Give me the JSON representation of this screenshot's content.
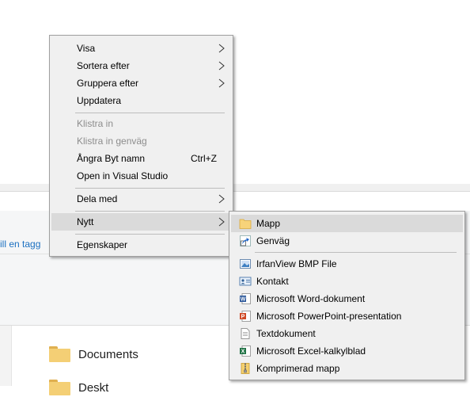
{
  "background": {
    "tag_link": "ill en tagg",
    "folders": [
      "Documents",
      "Deskt"
    ]
  },
  "context_menu": {
    "items": [
      {
        "label": "Visa",
        "submenu": true
      },
      {
        "label": "Sortera efter",
        "submenu": true
      },
      {
        "label": "Gruppera efter",
        "submenu": true
      },
      {
        "label": "Uppdatera"
      },
      {
        "label": "Klistra in",
        "disabled": true
      },
      {
        "label": "Klistra in genväg",
        "disabled": true
      },
      {
        "label": "Ångra Byt namn",
        "shortcut": "Ctrl+Z"
      },
      {
        "label": "Open in Visual Studio"
      },
      {
        "label": "Dela med",
        "submenu": true
      },
      {
        "label": "Nytt",
        "submenu": true,
        "highlighted": true
      },
      {
        "label": "Egenskaper"
      }
    ]
  },
  "new_submenu": {
    "items": [
      {
        "label": "Mapp",
        "icon": "folder-icon",
        "highlighted": true
      },
      {
        "label": "Genväg",
        "icon": "shortcut-icon"
      },
      {
        "label": "IrfanView BMP File",
        "icon": "bmp-image-icon"
      },
      {
        "label": "Kontakt",
        "icon": "contact-card-icon"
      },
      {
        "label": "Microsoft Word-dokument",
        "icon": "word-document-icon"
      },
      {
        "label": "Microsoft PowerPoint-presentation",
        "icon": "powerpoint-icon"
      },
      {
        "label": "Textdokument",
        "icon": "text-document-icon"
      },
      {
        "label": "Microsoft Excel-kalkylblad",
        "icon": "excel-icon"
      },
      {
        "label": "Komprimerad mapp",
        "icon": "zip-folder-icon"
      }
    ]
  }
}
